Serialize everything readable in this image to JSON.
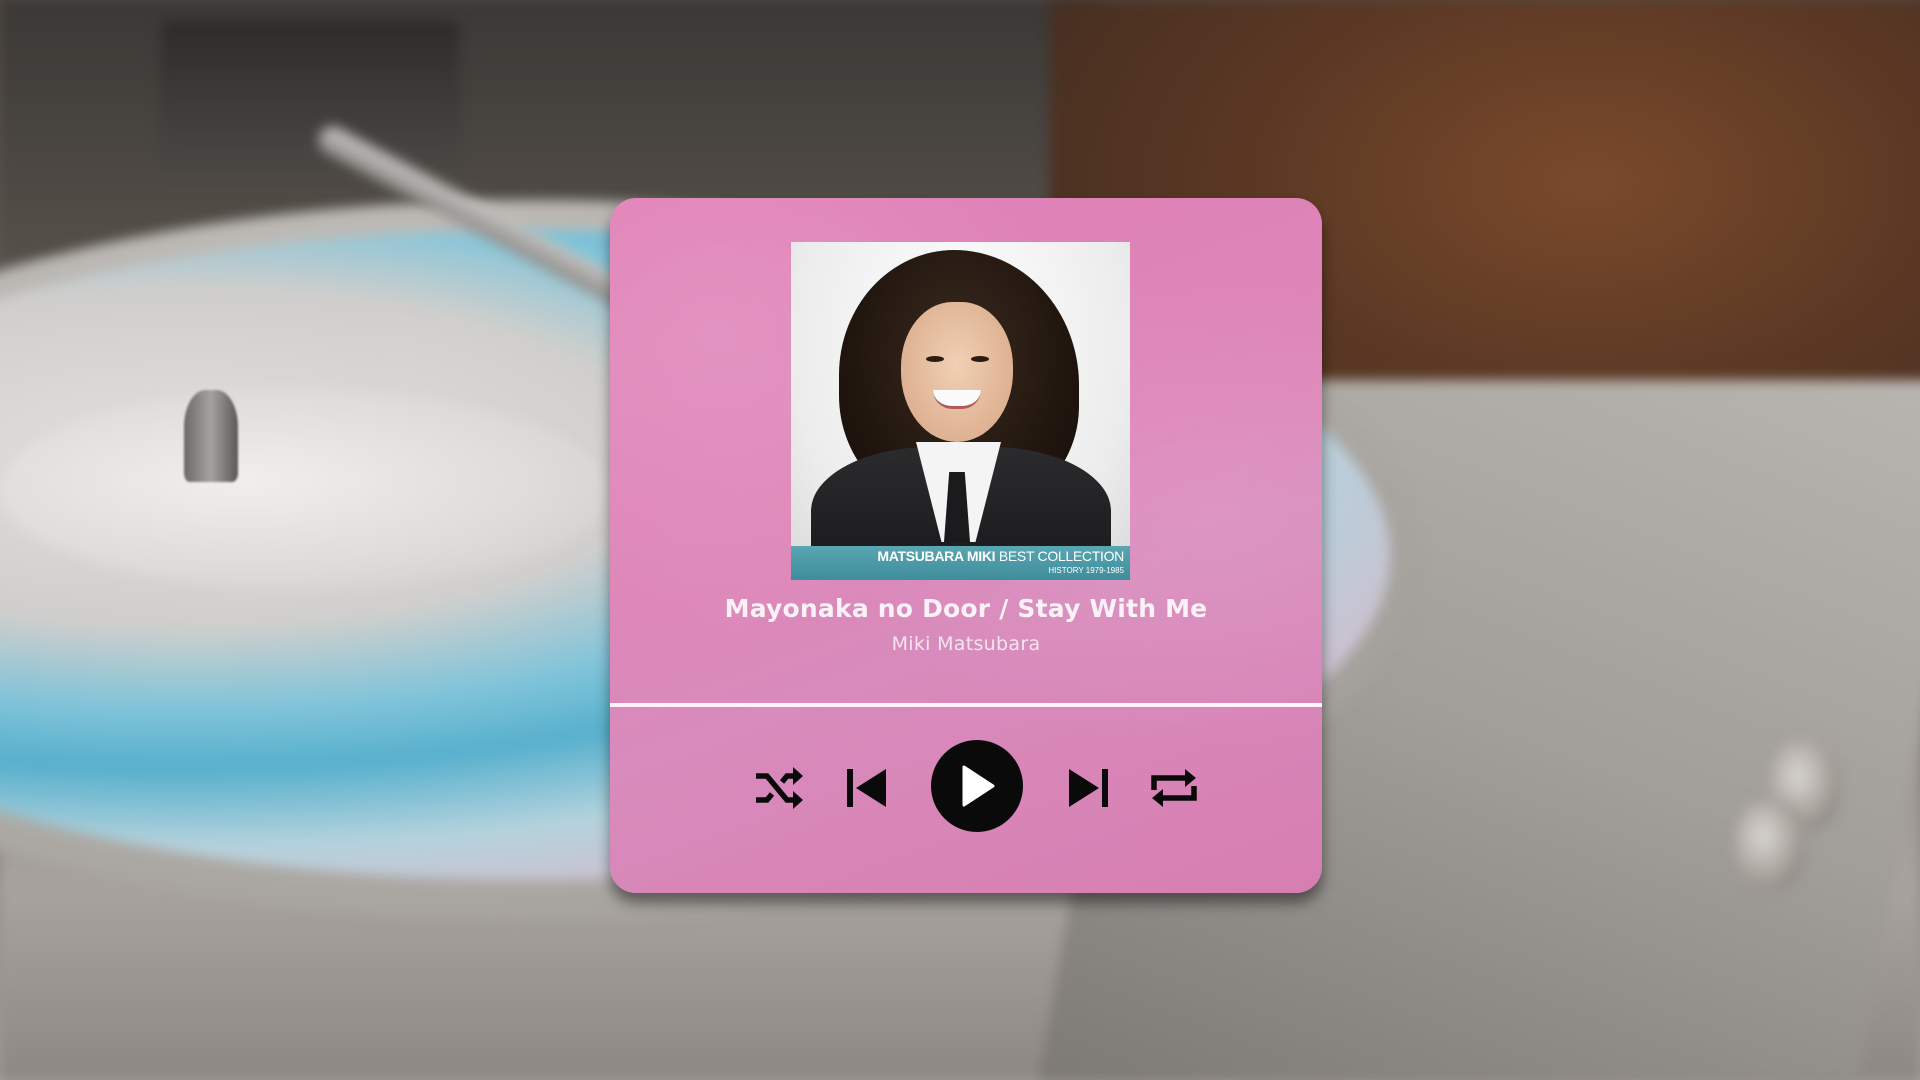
{
  "player": {
    "song_title": "Mayonaka no Door / Stay With Me",
    "artist": "Miki Matsubara",
    "progress": 1.0,
    "album": {
      "banner_title_bold": "MATSUBARA MIKI",
      "banner_title_rest": " BEST COLLECTION",
      "banner_subtitle": "HISTORY 1979-1985"
    },
    "controls": {
      "shuffle_icon": "shuffle-icon",
      "previous_icon": "skip-previous-icon",
      "play_icon": "play-icon",
      "next_icon": "skip-next-icon",
      "repeat_icon": "repeat-icon"
    },
    "colors": {
      "card": "#dd86b9",
      "play_button": "#0a0a0a",
      "text": "#fbf2f7"
    }
  }
}
